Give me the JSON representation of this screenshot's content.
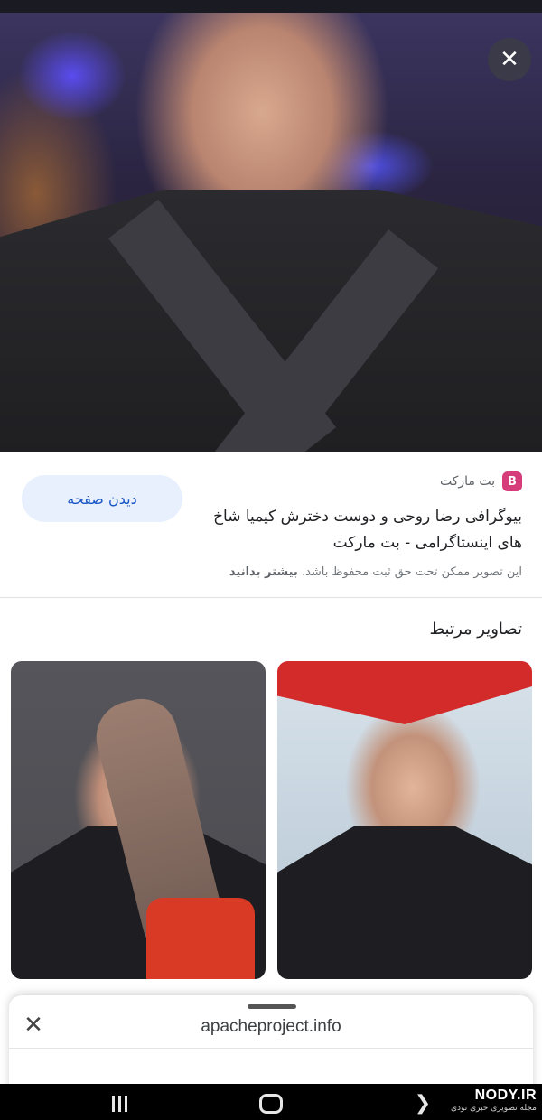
{
  "image_viewer": {
    "close_label": "✕"
  },
  "source": {
    "visit_button_label": "دیدن صفحه",
    "site_badge": "B",
    "site_name": "بت مارکت",
    "title": "بیوگرافی رضا روحی و دوست دخترش کیمیا شاخ های اینستاگرامی - بت مارکت",
    "copyright_text": "این تصویر ممکن تحت حق ثبت محفوظ باشد.",
    "learn_more_label": "بیشتر بدانید"
  },
  "related": {
    "heading": "تصاویر مرتبط"
  },
  "bottom_sheet": {
    "close_label": "✕",
    "url": "apacheproject.info"
  },
  "watermark": {
    "logo": "NODY.IR",
    "tagline": "مجله تصویری خبری نودی"
  },
  "colors": {
    "accent": "#1a56c4",
    "visit_button_bg": "#e8f0fe",
    "site_badge": "#d63c7a"
  },
  "icons": {
    "close": "close-icon",
    "recents": "recents-icon",
    "home": "home-icon",
    "back": "back-icon"
  }
}
